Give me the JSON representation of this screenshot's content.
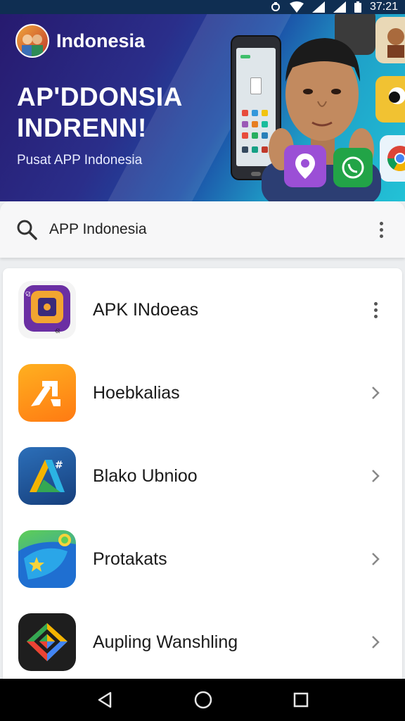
{
  "status_bar": {
    "time": "37:21"
  },
  "banner": {
    "brand": "Indonesia",
    "headline_line1": "AP'DDONSIA",
    "headline_line2": "INDRENN!",
    "subtitle": "Pusat APP Indonesia"
  },
  "search": {
    "text": "APP Indonesia"
  },
  "apps": [
    {
      "name": "APK INdoeas",
      "trail": "more-vert-icon"
    },
    {
      "name": "Hoebkalias",
      "trail": "chevron-right-icon"
    },
    {
      "name": "Blako Ubnioo",
      "trail": "chevron-right-icon"
    },
    {
      "name": "Protakats",
      "trail": "chevron-right-icon"
    },
    {
      "name": "Aupling Wanshling",
      "trail": "chevron-right-icon"
    }
  ],
  "navigation": [
    "back-icon",
    "home-icon",
    "recents-icon"
  ],
  "colors": {
    "status_bar": "#0f2e52",
    "banner_start": "#271a6f",
    "banner_end": "#22c2d6"
  }
}
